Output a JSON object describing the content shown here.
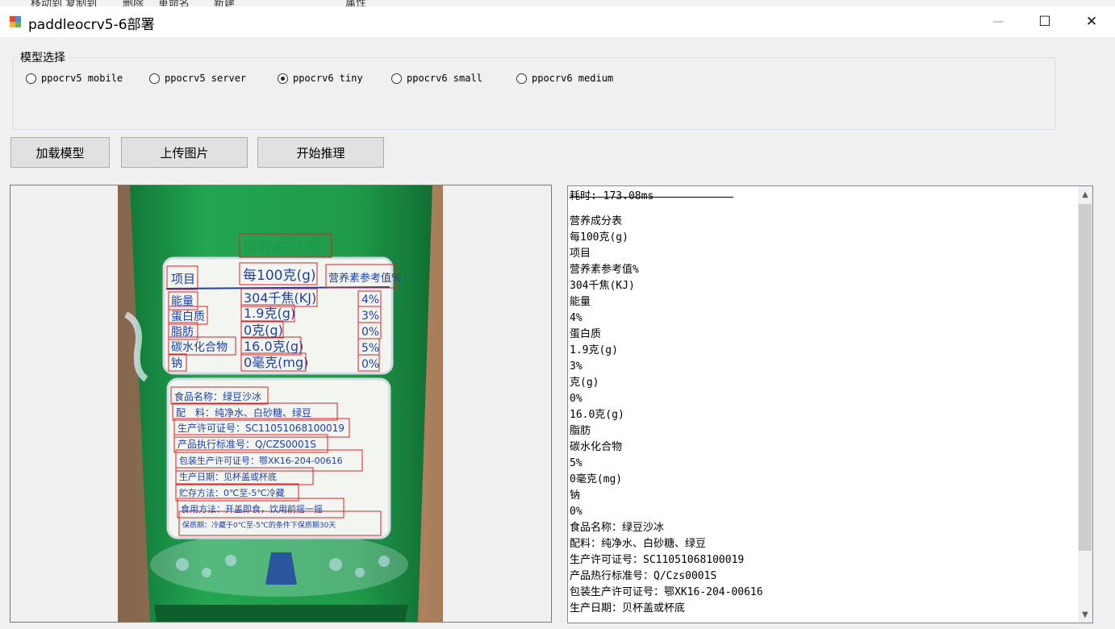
{
  "background_window": {
    "toolbar_labels": [
      "移动到 复制到",
      "删除",
      "重命名",
      "新建",
      "属性"
    ]
  },
  "window": {
    "title": "paddleocrv5-6部署",
    "minimize_label": "—",
    "maximize_label": "☐",
    "close_label": "✕"
  },
  "model_group": {
    "legend": "模型选择",
    "options": [
      {
        "label": "ppocrv5 mobile",
        "checked": false
      },
      {
        "label": "ppocrv5 server",
        "checked": false
      },
      {
        "label": "ppocrv6 tiny",
        "checked": true
      },
      {
        "label": "ppocrv6 small",
        "checked": false
      },
      {
        "label": "ppocrv6 medium",
        "checked": false
      }
    ]
  },
  "buttons": {
    "load_model": "加载模型",
    "upload_image": "上传图片",
    "start_inference": "开始推理"
  },
  "image": {
    "title": "营养成分表",
    "header": {
      "item": "项目",
      "per100": "每100克(g)",
      "nrv": "营养素参考值%"
    },
    "rows": [
      {
        "name": "能量",
        "value": "304千焦(KJ)",
        "nrv": "4%"
      },
      {
        "name": "蛋白质",
        "value": "1.9克(g)",
        "nrv": "3%"
      },
      {
        "name": "脂肪",
        "value": "0克(g)",
        "nrv": "0%"
      },
      {
        "name": "碳水化合物",
        "value": "16.0克(g)",
        "nrv": "5%"
      },
      {
        "name": "钠",
        "value": "0毫克(mg)",
        "nrv": "0%"
      }
    ],
    "info_lines": [
      "食品名称：绿豆沙冰",
      "配　料：纯净水、白砂糖、绿豆",
      "生产许可证号：SC11051068100019",
      "产品执行标准号：Q/CZS0001S",
      "包装生产许可证号：鄂XK16-204-00616",
      "生产日期：见杯盖或杯底",
      "贮存方法：0℃至-5℃冷藏",
      "食用方法：开盖即食，饮用前摇一摇",
      "保质期：冷藏于0℃至-5℃的条件下保质期30天"
    ]
  },
  "output": {
    "timing": "耗时: 173.08ms",
    "lines": [
      "营养成分表",
      "每100克(g)",
      "项目",
      "营养素参考值%",
      "304千焦(KJ)",
      "能量",
      "4%",
      "蛋白质",
      "1.9克(g)",
      "3%",
      "克(g)",
      "0%",
      "16.0克(g)",
      "脂肪",
      "碳水化合物",
      "5%",
      "0毫克(mg)",
      "钠",
      "0%",
      "食品名称：绿豆沙冰",
      "配料：纯净水、白砂糖、绿豆",
      "生产许可证号：SC11051068100019",
      "产品热行标准号：Q/Czs0001S",
      "包装生产许可证号：鄂XK16-204-00616",
      "生产日期：贝杯盖或杯底"
    ]
  },
  "colors": {
    "window_bg": "#f0f0f0",
    "cup_green": "#1f9a49",
    "label_blue": "#1f3fa6",
    "ocr_box_red": "#e02020"
  }
}
